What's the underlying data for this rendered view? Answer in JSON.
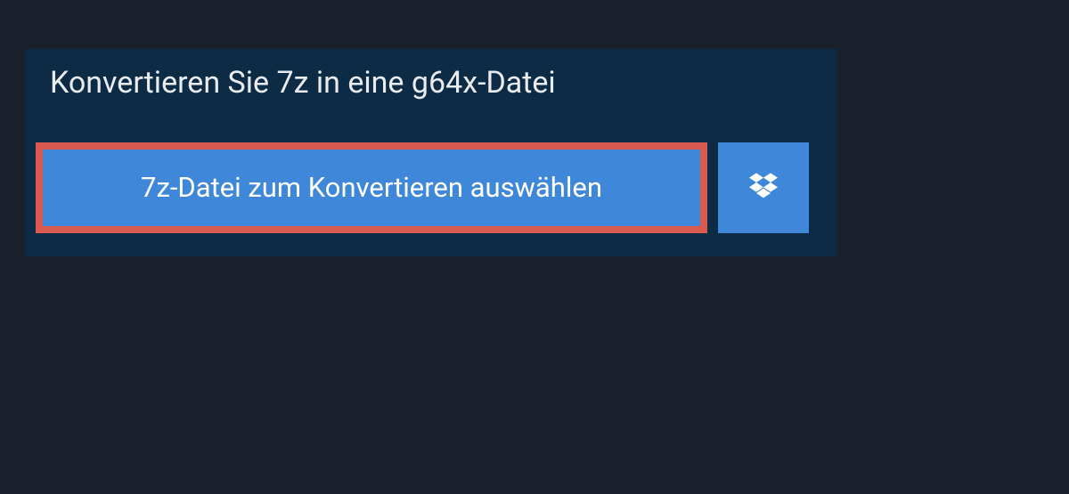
{
  "heading": "Konvertieren Sie 7z in eine g64x-Datei",
  "select_button_label": "7z-Datei zum Konvertieren auswählen",
  "colors": {
    "panel_bg": "#0e2b45",
    "page_bg": "#1a202c",
    "button_bg": "#3f87d9",
    "highlight_border": "#d95b4f",
    "text_light": "#e8ecef"
  }
}
